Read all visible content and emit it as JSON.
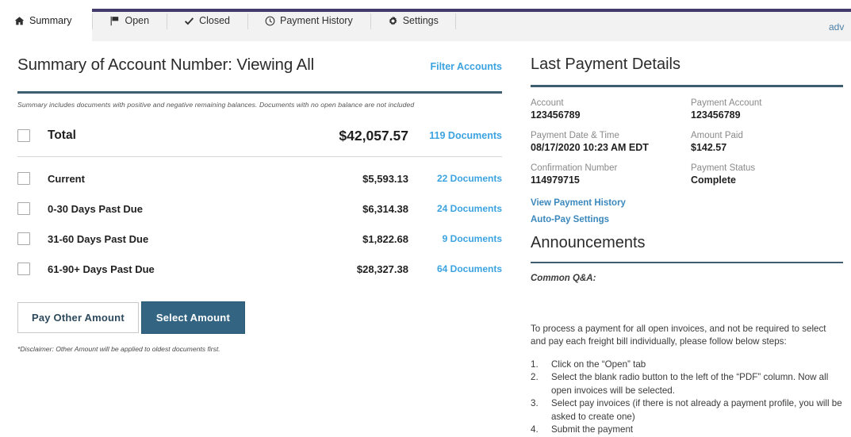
{
  "tabs": [
    {
      "id": "summary",
      "label": "Summary",
      "icon": "home-icon",
      "active": true
    },
    {
      "id": "open",
      "label": "Open",
      "icon": "flag-icon",
      "active": false
    },
    {
      "id": "closed",
      "label": "Closed",
      "icon": "check-icon",
      "active": false
    },
    {
      "id": "payment-history",
      "label": "Payment History",
      "icon": "clock-icon",
      "active": false
    },
    {
      "id": "settings",
      "label": "Settings",
      "icon": "gear-icon",
      "active": false
    }
  ],
  "tabbar": {
    "overflow_text": "adv",
    "accent_color": "#433b6b"
  },
  "summary": {
    "title": "Summary of Account Number: Viewing All",
    "filter_link": "Filter Accounts",
    "note": "Summary includes documents with positive and negative remaining balances. Documents with no open balance are not included",
    "rows": [
      {
        "label": "Total",
        "amount": "$42,057.57",
        "documents": "119 Documents",
        "total": true
      },
      {
        "label": "Current",
        "amount": "$5,593.13",
        "documents": "22 Documents",
        "total": false
      },
      {
        "label": "0-30 Days Past Due",
        "amount": "$6,314.38",
        "documents": "24 Documents",
        "total": false
      },
      {
        "label": "31-60 Days Past Due",
        "amount": "$1,822.68",
        "documents": "9 Documents",
        "total": false
      },
      {
        "label": "61-90+ Days Past Due",
        "amount": "$28,327.38",
        "documents": "64 Documents",
        "total": false
      }
    ],
    "pay_other_button": "Pay Other Amount",
    "select_amount_button": "Select Amount",
    "disclaimer": "*Disclaimer: Other Amount will be applied to oldest documents first."
  },
  "last_payment": {
    "title": "Last Payment Details",
    "fields": [
      {
        "label": "Account",
        "value": "123456789"
      },
      {
        "label": "Payment Account",
        "value": "123456789"
      },
      {
        "label": "Payment Date & Time",
        "value": "08/17/2020 10:23 AM EDT"
      },
      {
        "label": "Amount Paid",
        "value": "$142.57"
      },
      {
        "label": "Confirmation Number",
        "value": "114979715"
      },
      {
        "label": "Payment Status",
        "value": "Complete"
      }
    ],
    "links": [
      {
        "label": "View Payment History"
      },
      {
        "label": "Auto-Pay Settings"
      }
    ]
  },
  "announcements": {
    "title": "Announcements",
    "subtitle": "Common Q&A:",
    "body": "To process a payment for all open invoices, and not be required to select and pay each freight bill individually, please follow below steps:",
    "steps": [
      {
        "n": "1.",
        "text": "Click on the “Open” tab"
      },
      {
        "n": "2.",
        "text": "Select the blank radio button to the left of the “PDF” column. Now all open invoices will be selected."
      },
      {
        "n": "3.",
        "text": "Select pay invoices (if there is not already a payment profile, you will be asked to create one)"
      },
      {
        "n": "4.",
        "text": "Submit the payment"
      }
    ]
  },
  "colors": {
    "link": "#3ba3e0",
    "rule": "#3f5d70",
    "primary_button": "#336583",
    "tab_accent": "#433b6b"
  }
}
